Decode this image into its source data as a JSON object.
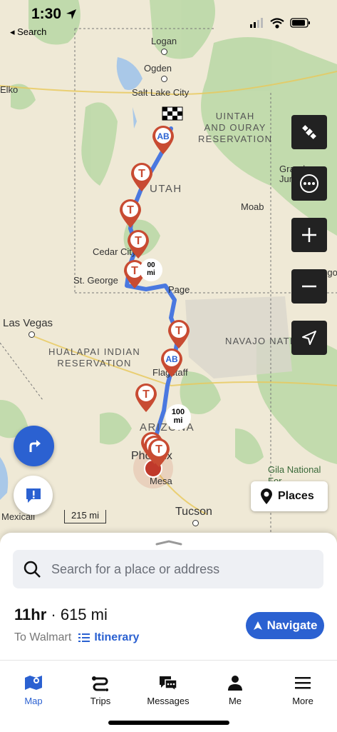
{
  "status_bar": {
    "time": "1:30",
    "back_label": "◂ Search"
  },
  "map": {
    "labels": {
      "logan": "Logan",
      "ogden": "Ogden",
      "salt_lake_city": "Salt Lake City",
      "elko": "Elko",
      "uintah_ouray": "UINTAH\nAND OURAY\nRESERVATION",
      "grand_junction": "Grand\nJunct",
      "utah": "UTAH",
      "moab": "Moab",
      "cedar_city": "Cedar City",
      "st_george": "St. George",
      "page": "Page",
      "durango": "Durango",
      "las_vegas": "Las Vegas",
      "hualapai": "HUALAPAI INDIAN\nRESERVATION",
      "navajo": "NAVAJO NATION",
      "flagstaff": "Flagstaff",
      "arizona": "ARIZONA",
      "phoenix": "Phoenix",
      "mesa": "Mesa",
      "gila": "Gila National\nFor",
      "tucson": "Tucson",
      "mexicali": "Mexicali"
    },
    "markers": {
      "t": "T",
      "ab": "AB",
      "mi_100": "100\nmi",
      "mi_00": "00\nmi"
    },
    "scale": "215 mi",
    "places_label": "Places"
  },
  "controls": {
    "satellite_icon": "satellite-icon",
    "more_icon": "more-icon",
    "zoom_in_icon": "zoom-in-icon",
    "zoom_out_icon": "zoom-out-icon",
    "locate_icon": "locate-icon"
  },
  "search": {
    "placeholder": "Search for a place or address"
  },
  "route": {
    "duration": "11hr",
    "distance": "· 615 mi",
    "destination": "To Walmart",
    "itinerary_label": "Itinerary",
    "navigate_label": "Navigate"
  },
  "tabs": [
    {
      "label": "Map",
      "icon": "map-icon"
    },
    {
      "label": "Trips",
      "icon": "trips-icon"
    },
    {
      "label": "Messages",
      "icon": "messages-icon"
    },
    {
      "label": "Me",
      "icon": "person-icon"
    },
    {
      "label": "More",
      "icon": "menu-icon"
    }
  ],
  "colors": {
    "accent": "#2b61d1",
    "route": "#4a78e0",
    "marker": "#c84b32",
    "map_bg": "#efe9d6",
    "green": "#bcd9a8"
  }
}
